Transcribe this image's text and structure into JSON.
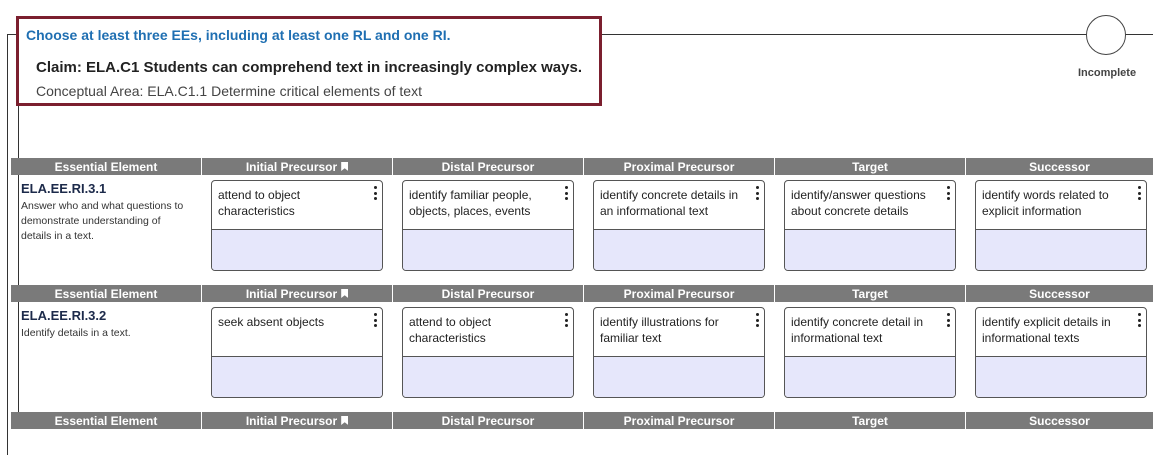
{
  "instruction": "Choose at least three EEs, including at least one RL and one RI.",
  "claim": "Claim: ELA.C1 Students can comprehend text in increasingly complex ways.",
  "conceptual_area": "Conceptual Area: ELA.C1.1 Determine critical elements of text",
  "status": "Incomplete",
  "headers": {
    "essential": "Essential Element",
    "initial": "Initial Precursor",
    "distal": "Distal Precursor",
    "proximal": "Proximal Precursor",
    "target": "Target",
    "successor": "Successor"
  },
  "rows": [
    {
      "code": "ELA.EE.RI.3.1",
      "description": "Answer who and what questions to demonstrate understanding of details in a text.",
      "nodes": [
        "attend to object characteristics",
        "identify familiar people, objects, places, events",
        "identify concrete details in an informational text",
        "identify/answer questions about concrete details",
        "identify words related to explicit information"
      ]
    },
    {
      "code": "ELA.EE.RI.3.2",
      "description": "Identify details in a text.",
      "nodes": [
        "seek absent objects",
        "attend to object characteristics",
        "identify illustrations for familiar text",
        "identify concrete detail in informational text",
        "identify explicit details in informational texts"
      ]
    }
  ]
}
